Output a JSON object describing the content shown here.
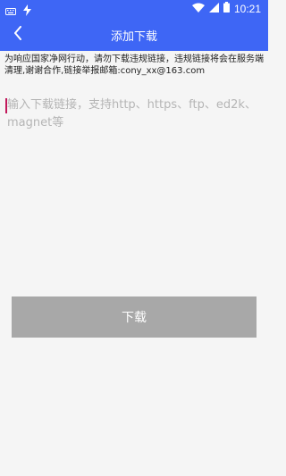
{
  "status_bar": {
    "time": "10:21",
    "icons": [
      "keyboard-icon",
      "flash-icon",
      "wifi-icon",
      "signal-icon",
      "battery-icon"
    ]
  },
  "app_bar": {
    "title": "添加下载",
    "back_icon": "back-arrow-icon"
  },
  "notice": {
    "text": "为响应国家净网行动，请勿下载违规链接，违规链接将会在服务端清理,谢谢合作,链接举报邮箱:cony_xx@163.com"
  },
  "input": {
    "value": "",
    "placeholder": "输入下载链接，支持http、https、ftp、ed2k、magnet等"
  },
  "actions": {
    "download_label": "下载"
  },
  "colors": {
    "primary": "#3e66f5",
    "background": "#f5f5f5",
    "button_disabled": "#a8a8a8"
  }
}
